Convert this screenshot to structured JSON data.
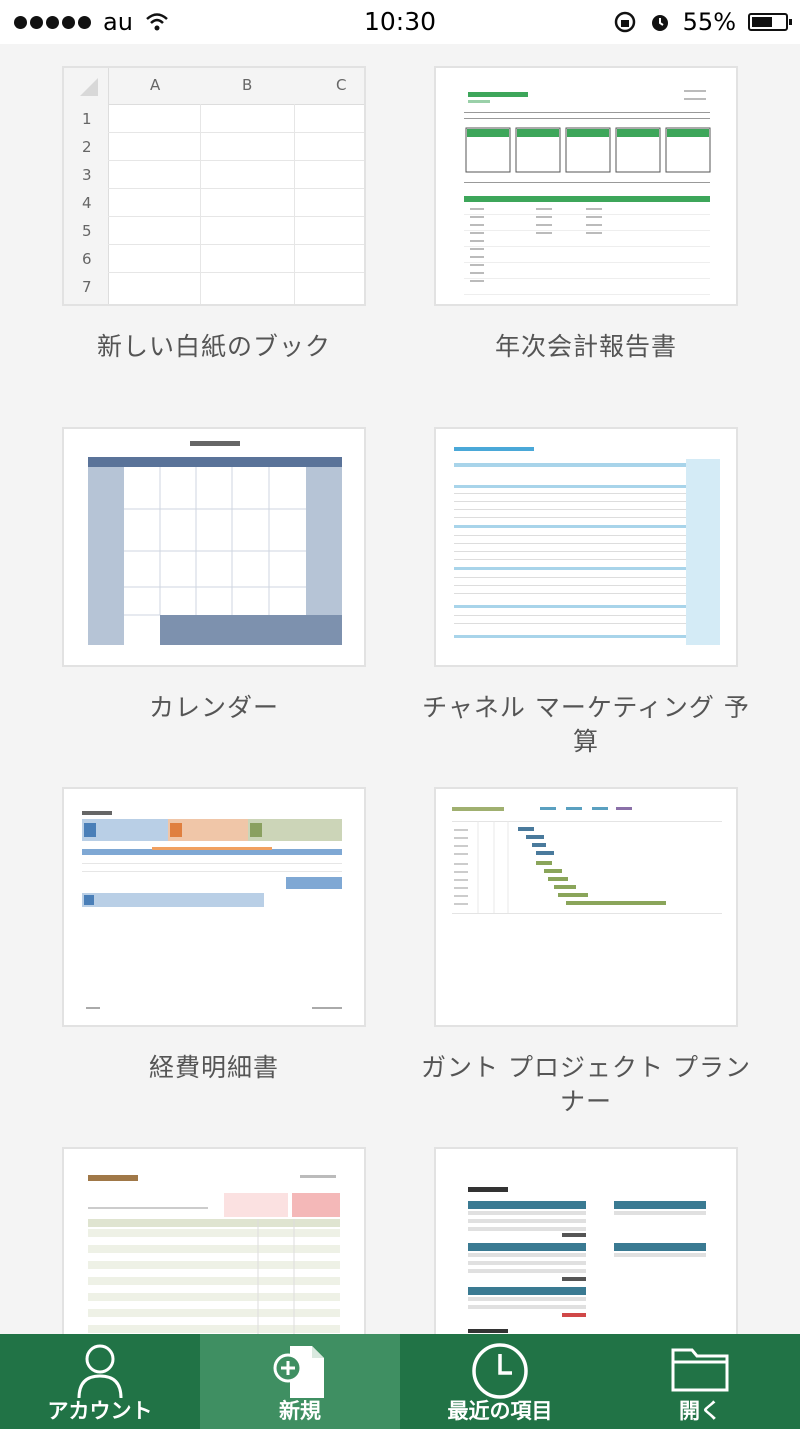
{
  "status_bar": {
    "carrier": "au",
    "time": "10:30",
    "battery": "55%"
  },
  "templates": [
    {
      "label": "新しい白紙のブック"
    },
    {
      "label": "年次会計報告書"
    },
    {
      "label": "カレンダー"
    },
    {
      "label": "チャネル マーケティング 予算"
    },
    {
      "label": "経費明細書"
    },
    {
      "label": "ガント プロジェクト プランナー"
    },
    {
      "label": ""
    },
    {
      "label": ""
    }
  ],
  "blank_sheet": {
    "columns": [
      "A",
      "B",
      "C"
    ],
    "rows": [
      "1",
      "2",
      "3",
      "4",
      "5",
      "6",
      "7"
    ]
  },
  "tabs": [
    {
      "label": "アカウント",
      "icon": "person-icon"
    },
    {
      "label": "新規",
      "icon": "new-document-icon"
    },
    {
      "label": "最近の項目",
      "icon": "clock-icon"
    },
    {
      "label": "開く",
      "icon": "folder-icon"
    }
  ],
  "colors": {
    "tab_bar": "#217346",
    "tab_active": "#3f8f62",
    "accent_green": "#3da65a"
  }
}
